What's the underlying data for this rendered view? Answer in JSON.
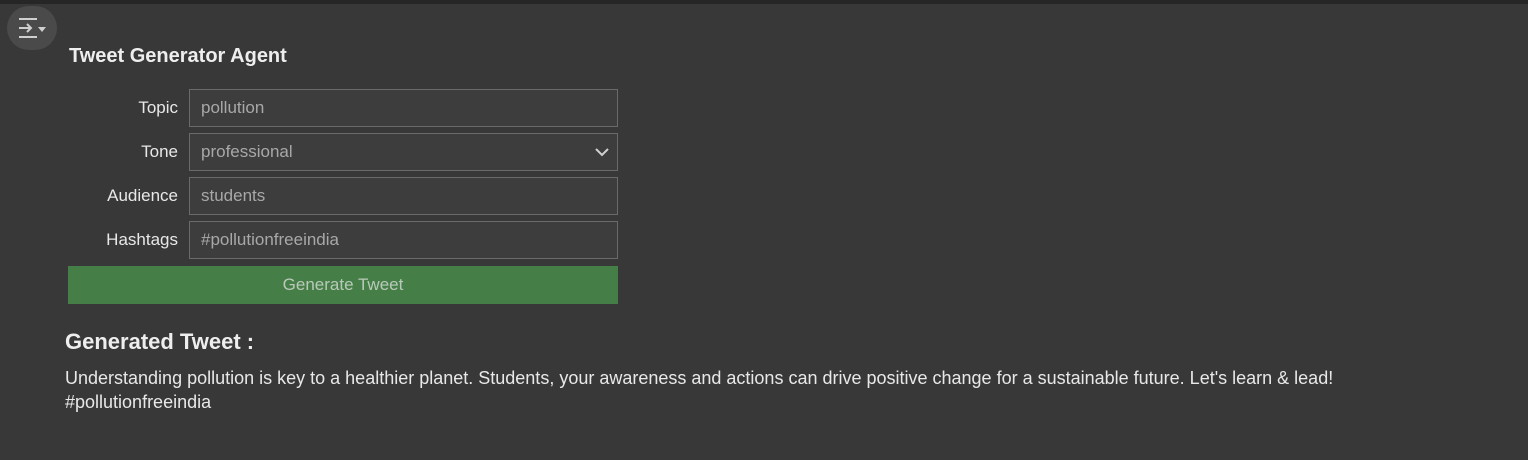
{
  "app": {
    "title": "Tweet Generator Agent"
  },
  "toolbar": {
    "toggle_icon": "collapse-panel-icon"
  },
  "form": {
    "topic": {
      "label": "Topic",
      "value": "pollution"
    },
    "tone": {
      "label": "Tone",
      "value": "professional",
      "icon": "chevron-down-icon"
    },
    "audience": {
      "label": "Audience",
      "value": "students"
    },
    "hashtags": {
      "label": "Hashtags",
      "value": "#pollutionfreeindia"
    },
    "submit_label": "Generate Tweet"
  },
  "result": {
    "heading": "Generated Tweet :",
    "line1": "Understanding pollution is key to a healthier planet. Students, your awareness and actions can drive positive change for a sustainable future. Let's learn & lead!",
    "line2": "#pollutionfreeindia"
  },
  "colors": {
    "background": "#383838",
    "button_green": "#457f47",
    "field_border": "#6a6a6a"
  }
}
